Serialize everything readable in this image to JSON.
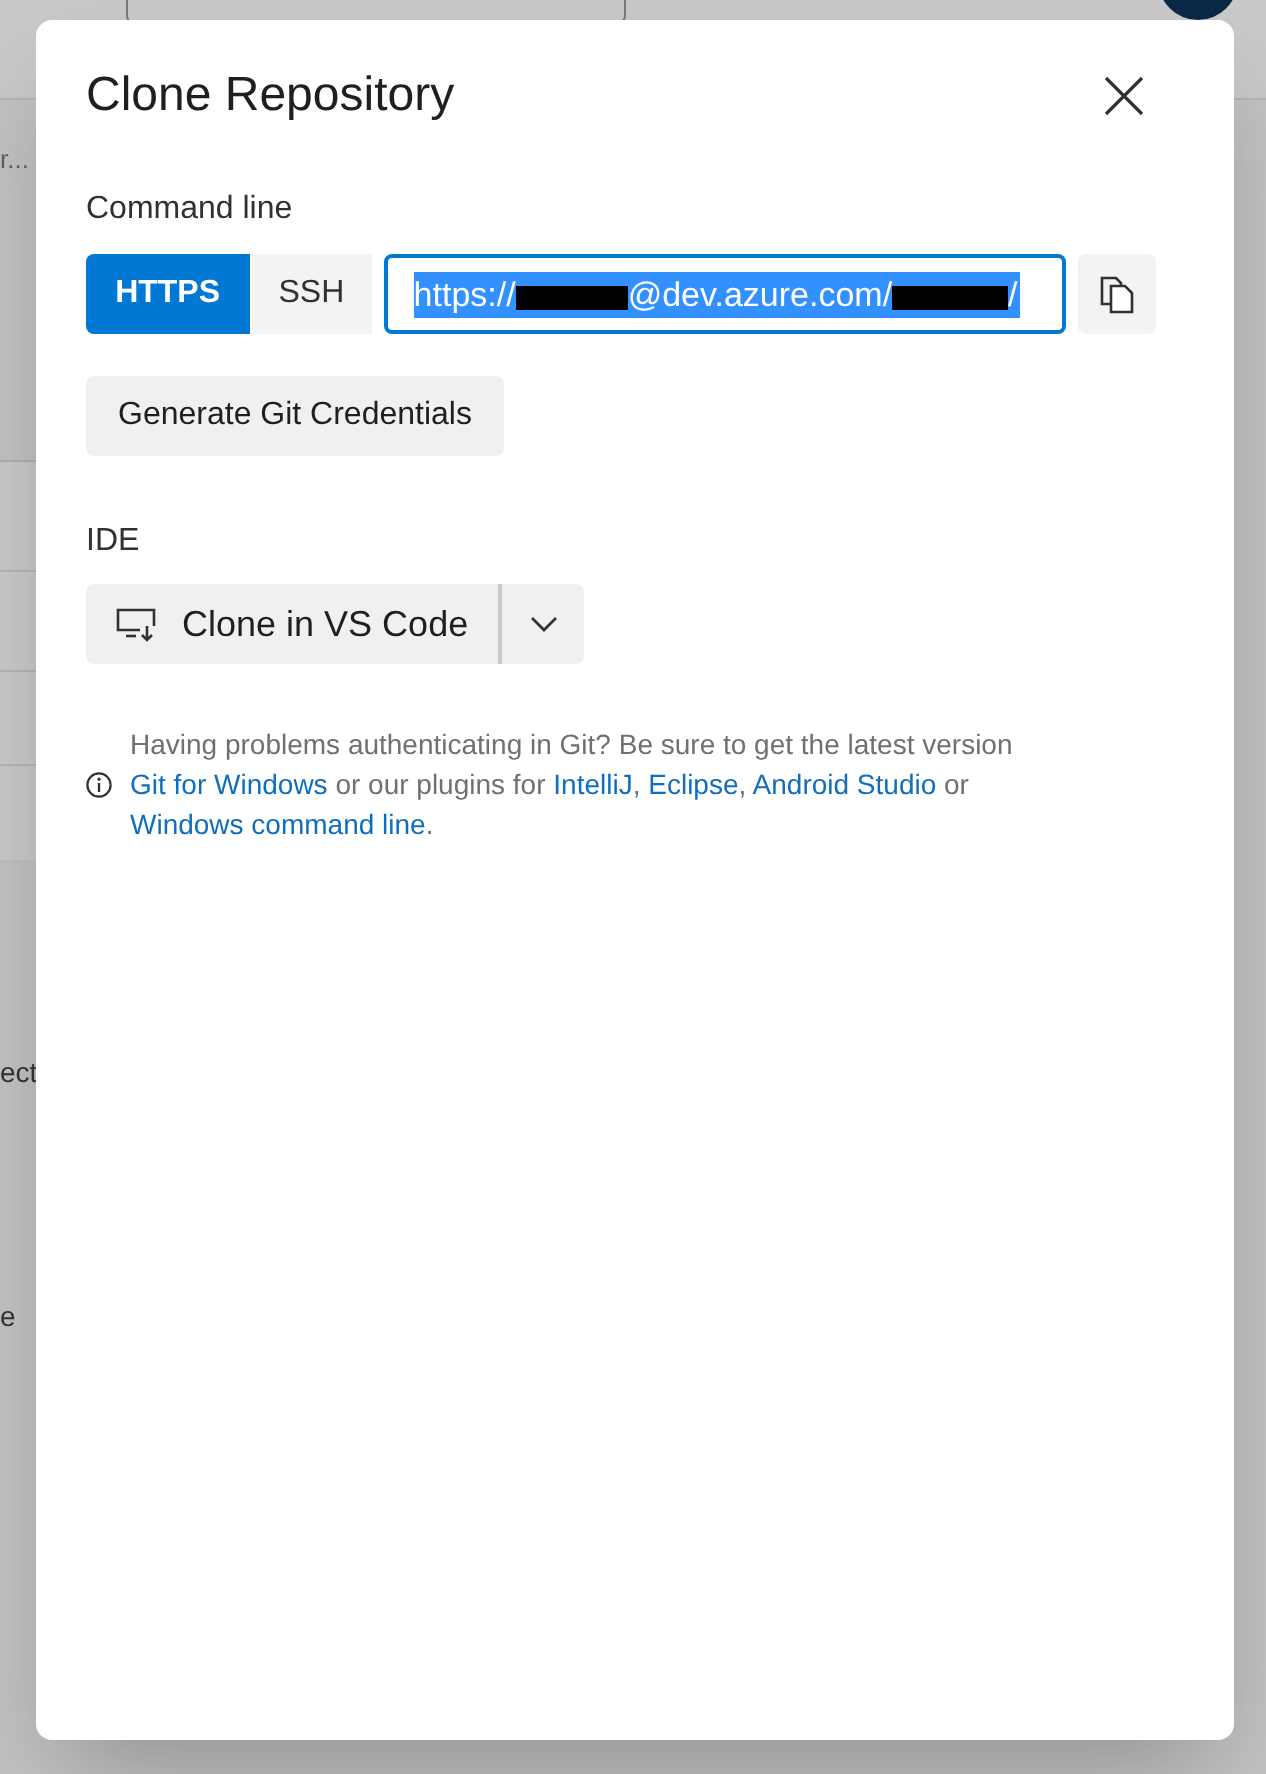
{
  "background": {
    "fragments": [
      "r...",
      "ect",
      "e"
    ]
  },
  "dialog": {
    "title": "Clone Repository"
  },
  "command_line": {
    "label": "Command line",
    "tabs": [
      {
        "label": "HTTPS",
        "selected": true
      },
      {
        "label": "SSH",
        "selected": false
      }
    ],
    "url": {
      "selected": true,
      "segments": [
        {
          "kind": "text",
          "text": "https://"
        },
        {
          "kind": "redacted"
        },
        {
          "kind": "text",
          "text": "@dev.azure.com/"
        },
        {
          "kind": "redacted"
        },
        {
          "kind": "text",
          "text": "/"
        }
      ]
    }
  },
  "generate_button": "Generate Git Credentials",
  "ide": {
    "label": "IDE",
    "button": "Clone in VS Code"
  },
  "help": [
    {
      "kind": "text",
      "text": "Having problems authenticating in Git? Be sure to get the latest version "
    },
    {
      "kind": "link",
      "text": "Git for Windows"
    },
    {
      "kind": "text",
      "text": " or our plugins for "
    },
    {
      "kind": "link",
      "text": "IntelliJ"
    },
    {
      "kind": "text",
      "text": ", "
    },
    {
      "kind": "link",
      "text": "Eclipse"
    },
    {
      "kind": "text",
      "text": ", "
    },
    {
      "kind": "link",
      "text": "Android Studio"
    },
    {
      "kind": "text",
      "text": " or "
    },
    {
      "kind": "link",
      "text": "Windows command line"
    },
    {
      "kind": "text",
      "text": "."
    }
  ]
}
